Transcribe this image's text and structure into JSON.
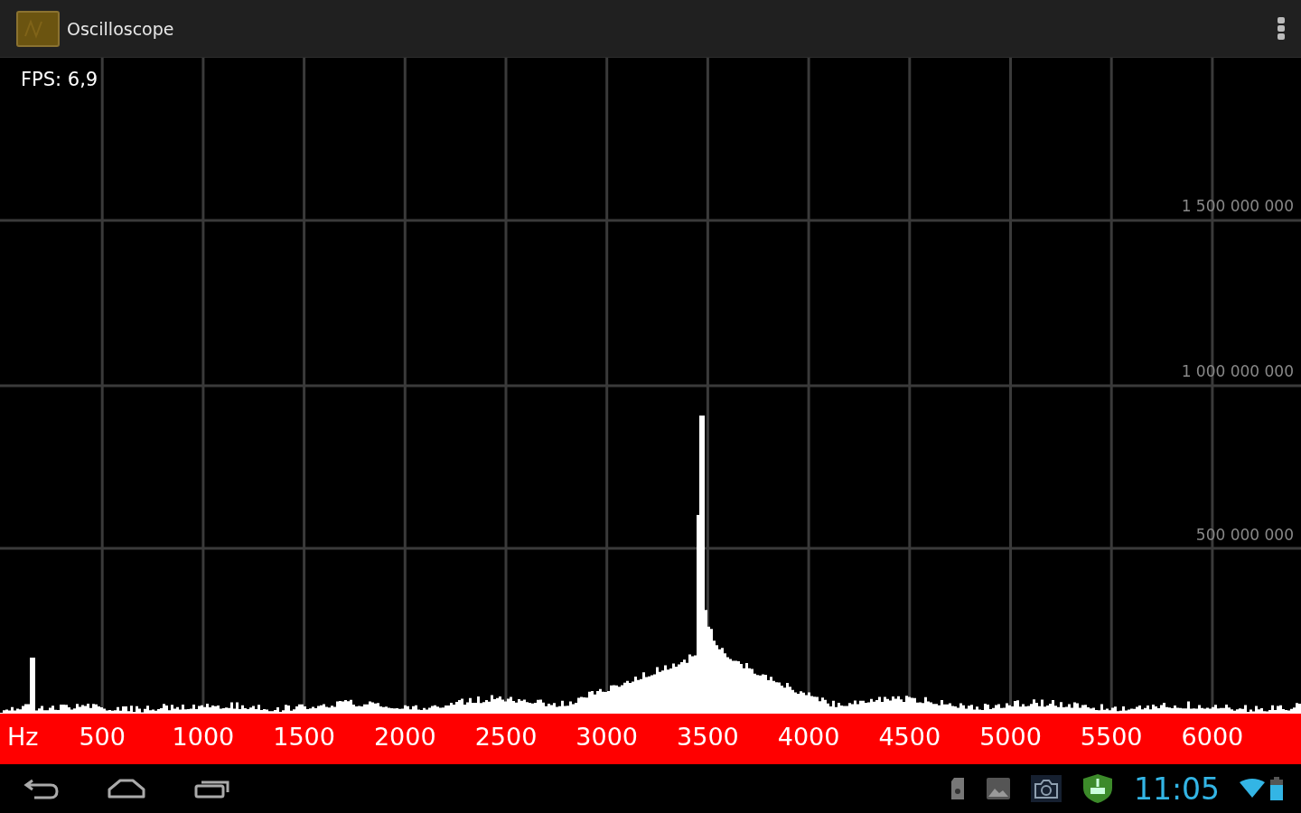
{
  "action_bar": {
    "title": "Oscilloscope"
  },
  "scope": {
    "fps": "FPS: 6,9",
    "y_labels": [
      "1 500 000 000",
      "1 000 000 000",
      "500 000 000"
    ],
    "x_unit": "Hz",
    "x_labels": [
      "500",
      "1000",
      "1500",
      "2000",
      "2500",
      "3000",
      "3500",
      "4000",
      "4500",
      "5000",
      "5500",
      "6000"
    ]
  },
  "system_bar": {
    "clock": "11:05"
  }
}
